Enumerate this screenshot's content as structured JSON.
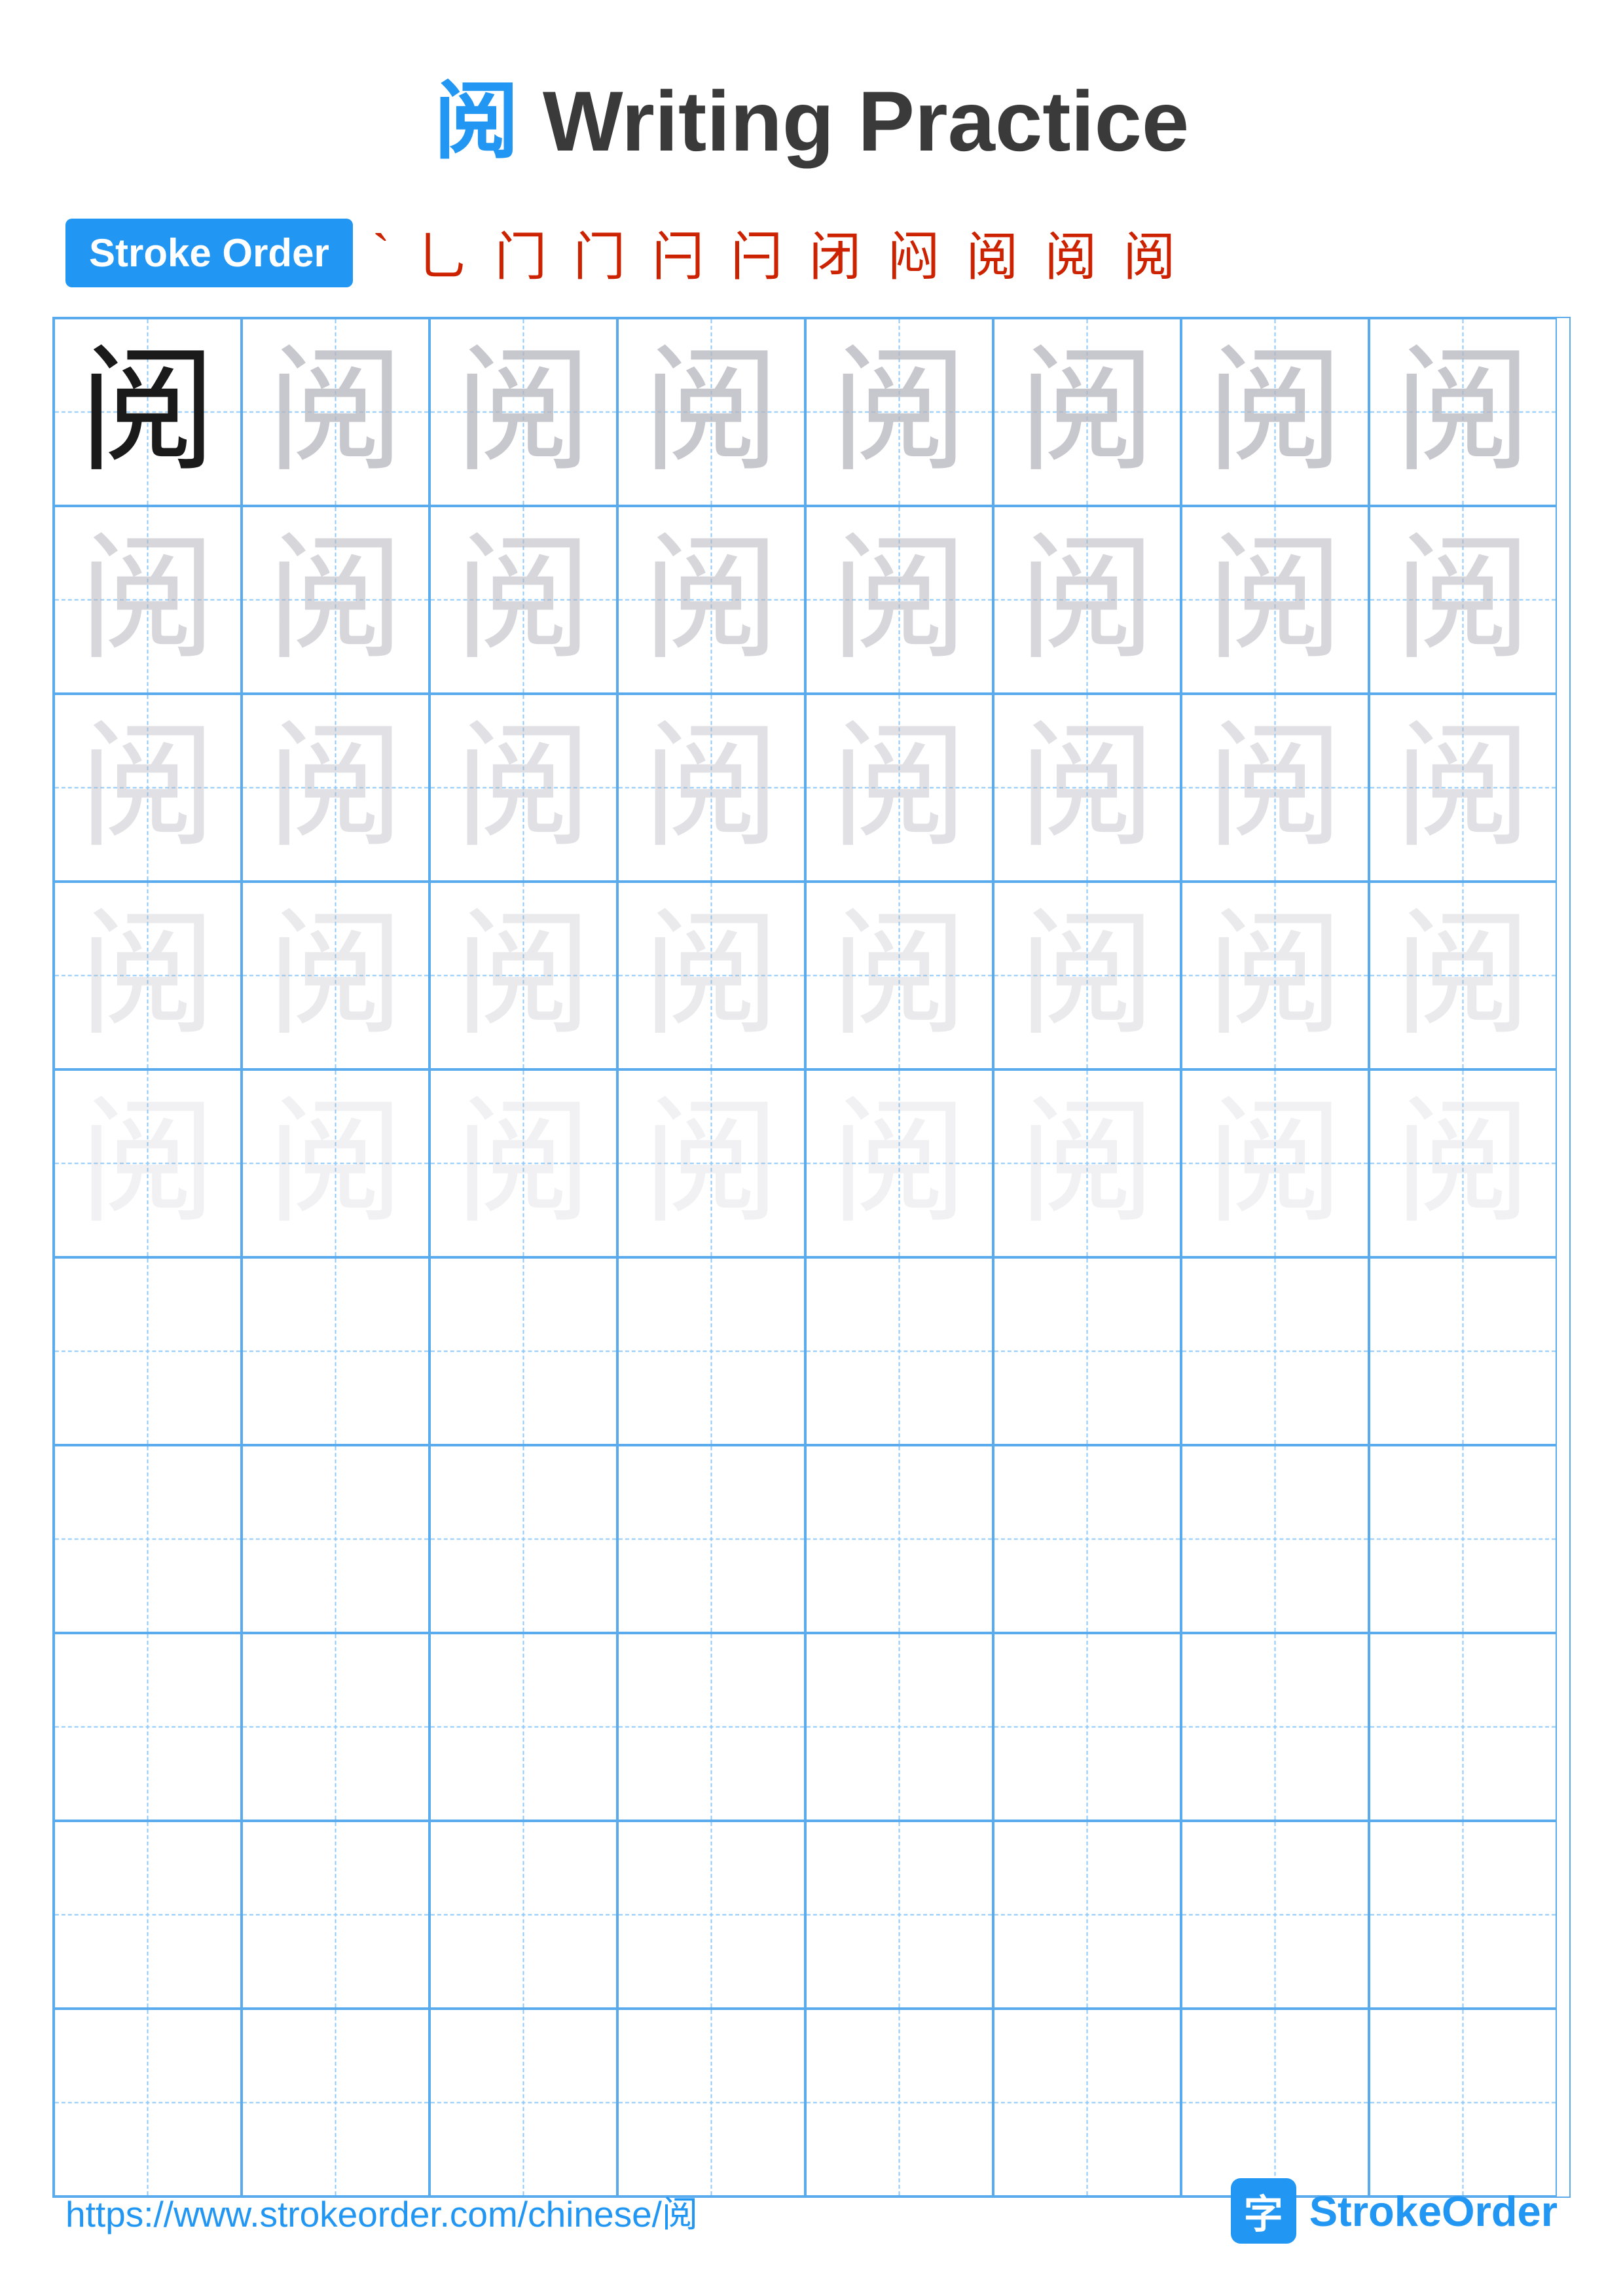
{
  "title": {
    "char": "阅",
    "text": " Writing Practice"
  },
  "stroke_order": {
    "badge_label": "Stroke Order",
    "steps": [
      "`",
      "⺃",
      "门",
      "门",
      "闩",
      "闩",
      "闭",
      "闷",
      "阅",
      "阅",
      "阅"
    ]
  },
  "grid": {
    "rows": 10,
    "cols": 8,
    "char": "阅"
  },
  "footer": {
    "url": "https://www.strokeorder.com/chinese/阅",
    "logo_text": "StrokeOrder",
    "logo_char": "字"
  }
}
